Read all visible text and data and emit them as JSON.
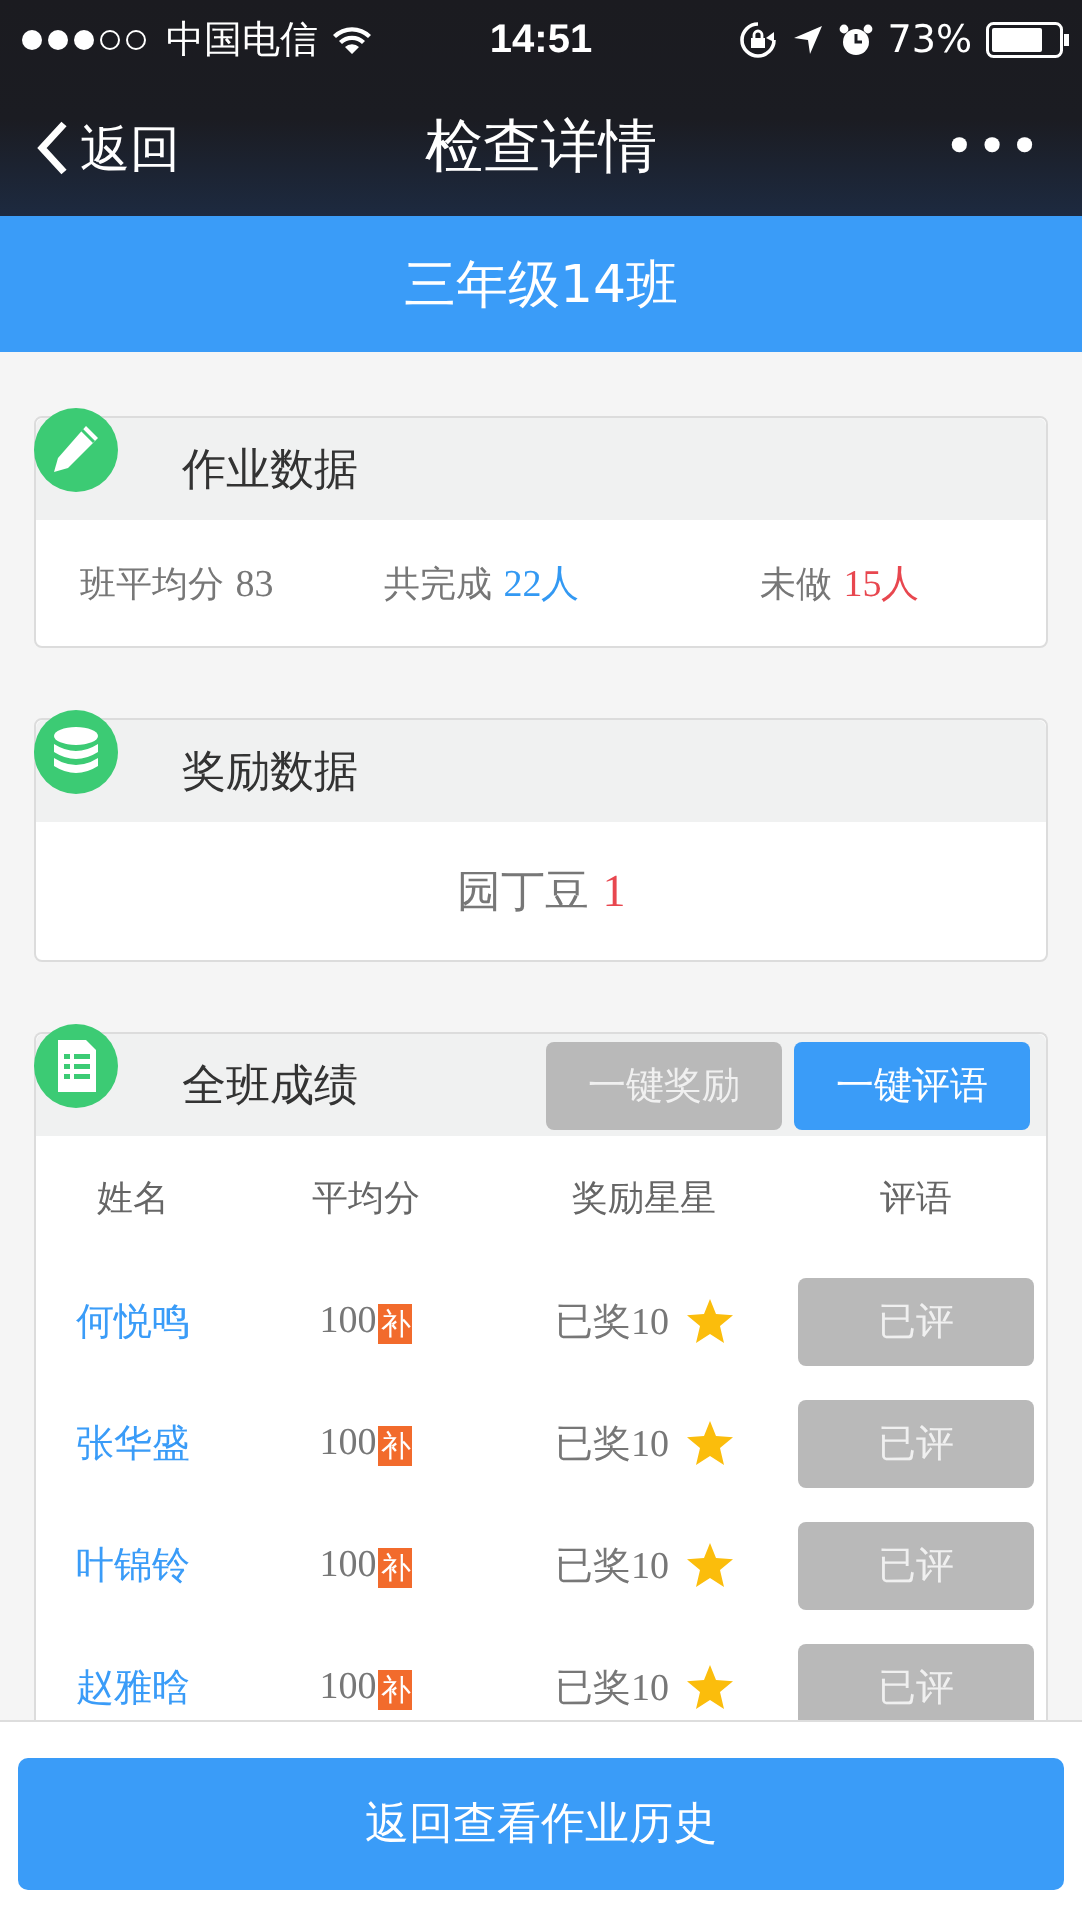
{
  "status_bar": {
    "carrier": "中国电信",
    "time": "14:51",
    "battery": "73%"
  },
  "nav": {
    "back": "返回",
    "title": "检查详情",
    "more": "•••"
  },
  "class_banner": "三年级14班",
  "homework": {
    "title": "作业数据",
    "stats": [
      {
        "label": "班平均分",
        "value": "83",
        "color": "#777777"
      },
      {
        "label": "共完成",
        "value": "22人",
        "color": "#3399f3"
      },
      {
        "label": "未做",
        "value": "15人",
        "color": "#e8474f"
      }
    ]
  },
  "reward": {
    "title": "奖励数据",
    "label": "园丁豆",
    "value": "1"
  },
  "scores": {
    "title": "全班成绩",
    "buttons": [
      {
        "label": "一键奖励",
        "disabled": true
      },
      {
        "label": "一键评语",
        "disabled": false
      }
    ],
    "columns": [
      "姓名",
      "平均分",
      "奖励星星",
      "评语"
    ],
    "rows": [
      {
        "name": "何悦鸣",
        "score": "100",
        "makeup": "补",
        "stars_text": "已奖10",
        "comment": "已评",
        "commented": true
      },
      {
        "name": "张华盛",
        "score": "100",
        "makeup": "补",
        "stars_text": "已奖10",
        "comment": "已评",
        "commented": true
      },
      {
        "name": "叶锦铃",
        "score": "100",
        "makeup": "补",
        "stars_text": "已奖10",
        "comment": "已评",
        "commented": true
      },
      {
        "name": "赵雅晗",
        "score": "100",
        "makeup": "补",
        "stars_text": "已奖10",
        "comment": "已评",
        "commented": true
      }
    ]
  },
  "footer_button": "返回查看作业历史"
}
